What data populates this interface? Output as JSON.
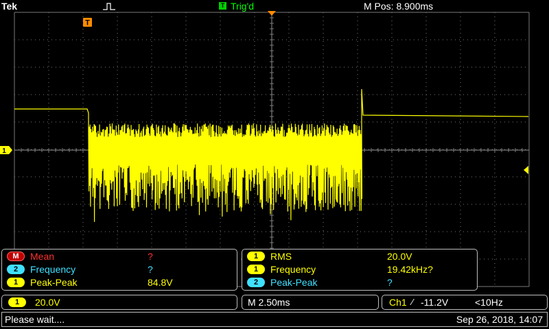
{
  "topbar": {
    "brand": "Tek",
    "trigger_status": "Trig'd",
    "trigger_marker": "T",
    "position_readout": "M Pos: 8.900ms"
  },
  "display": {
    "trace_color": "#ffff00",
    "grid_color": "#7a7a7a",
    "channel_marker": "1",
    "trigger_marker": "T"
  },
  "measurements_left": [
    {
      "badge": "M",
      "name": "Mean",
      "value": "?"
    },
    {
      "badge": "2",
      "name": "Frequency",
      "value": "?"
    },
    {
      "badge": "1",
      "name": "Peak-Peak",
      "value": "84.8V"
    }
  ],
  "measurements_right": [
    {
      "badge": "1",
      "name": "RMS",
      "value": "20.0V"
    },
    {
      "badge": "1",
      "name": "Frequency",
      "value": "19.42kHz?"
    },
    {
      "badge": "2",
      "name": "Peak-Peak",
      "value": "?"
    }
  ],
  "bottom": {
    "ch1_badge": "1",
    "ch1_scale": "20.0V",
    "timebase": "M 2.50ms",
    "trigger_source": "Ch1",
    "trigger_slope": "⁄",
    "trigger_level": "-11.2V",
    "trigger_freq": "<10Hz"
  },
  "status": {
    "message": "Please wait....",
    "datetime": "Sep 26, 2018, 14:07"
  }
}
